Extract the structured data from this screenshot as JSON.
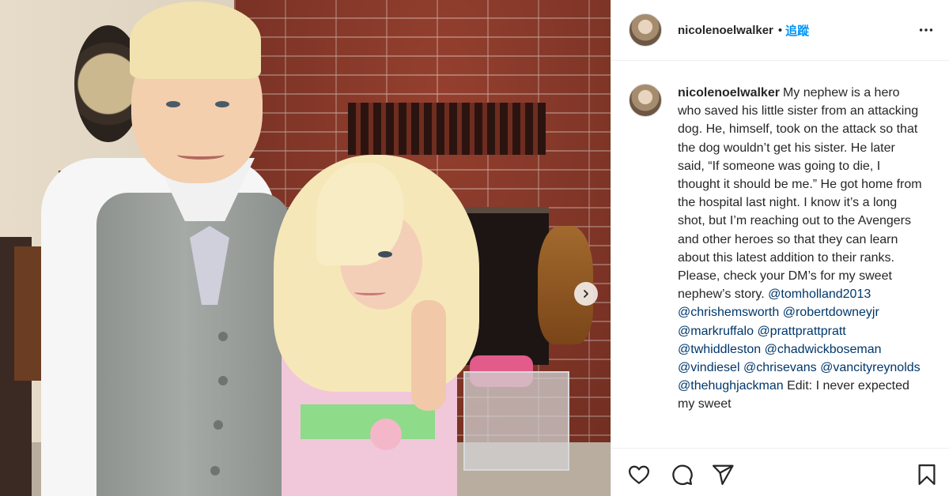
{
  "post": {
    "username": "nicolenoelwalker",
    "separator": "•",
    "follow_label": "追蹤",
    "more_icon": "more-horizontal-icon",
    "avatar_icon": "avatar"
  },
  "caption": {
    "username": "nicolenoelwalker",
    "text": "My nephew is a hero who saved his little sister from an attacking dog. He, himself, took on the attack so that the dog wouldn’t get his sister. He later said, “If someone was going to die, I thought it should be me.” He got home from the hospital last night. I know it’s a long shot, but I’m reaching out to the Avengers and other heroes so that they can learn about this latest addition to their ranks. Please, check your DM’s for my sweet nephew’s story.",
    "mentions": [
      "@tomholland2013",
      "@chrishemsworth",
      "@robertdowneyjr",
      "@markruffalo",
      "@prattprattpratt",
      "@twhiddleston",
      "@chadwickboseman",
      "@vindiesel",
      "@chrisevans",
      "@vancityreynolds",
      "@thehughjackman"
    ],
    "edit_text": "Edit: I never expected my sweet"
  },
  "actions": {
    "like_icon": "heart-icon",
    "comment_icon": "comment-icon",
    "share_icon": "share-icon",
    "save_icon": "bookmark-icon"
  },
  "photo": {
    "next_icon": "chevron-right-icon"
  },
  "colors": {
    "link_blue": "#0095f6",
    "mention": "#00376b",
    "text": "#262626",
    "divider": "#efefef"
  }
}
